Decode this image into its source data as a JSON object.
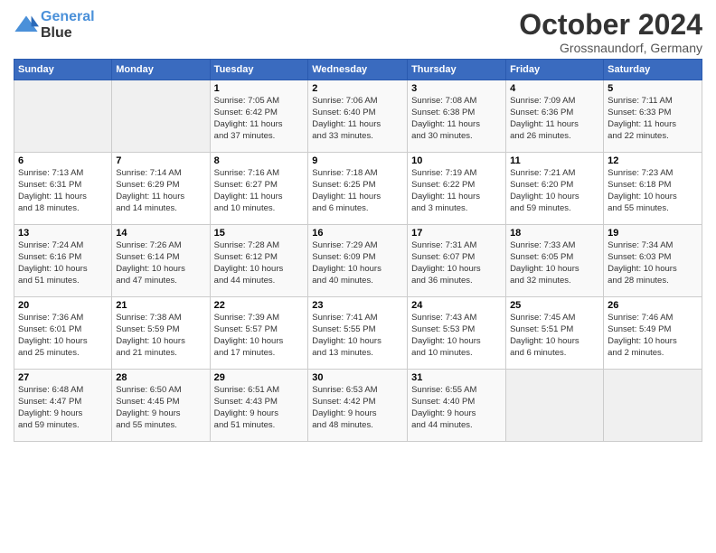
{
  "header": {
    "logo_line1": "General",
    "logo_line2": "Blue",
    "month": "October 2024",
    "location": "Grossnaundorf, Germany"
  },
  "weekdays": [
    "Sunday",
    "Monday",
    "Tuesday",
    "Wednesday",
    "Thursday",
    "Friday",
    "Saturday"
  ],
  "weeks": [
    [
      {
        "day": "",
        "info": ""
      },
      {
        "day": "",
        "info": ""
      },
      {
        "day": "1",
        "info": "Sunrise: 7:05 AM\nSunset: 6:42 PM\nDaylight: 11 hours\nand 37 minutes."
      },
      {
        "day": "2",
        "info": "Sunrise: 7:06 AM\nSunset: 6:40 PM\nDaylight: 11 hours\nand 33 minutes."
      },
      {
        "day": "3",
        "info": "Sunrise: 7:08 AM\nSunset: 6:38 PM\nDaylight: 11 hours\nand 30 minutes."
      },
      {
        "day": "4",
        "info": "Sunrise: 7:09 AM\nSunset: 6:36 PM\nDaylight: 11 hours\nand 26 minutes."
      },
      {
        "day": "5",
        "info": "Sunrise: 7:11 AM\nSunset: 6:33 PM\nDaylight: 11 hours\nand 22 minutes."
      }
    ],
    [
      {
        "day": "6",
        "info": "Sunrise: 7:13 AM\nSunset: 6:31 PM\nDaylight: 11 hours\nand 18 minutes."
      },
      {
        "day": "7",
        "info": "Sunrise: 7:14 AM\nSunset: 6:29 PM\nDaylight: 11 hours\nand 14 minutes."
      },
      {
        "day": "8",
        "info": "Sunrise: 7:16 AM\nSunset: 6:27 PM\nDaylight: 11 hours\nand 10 minutes."
      },
      {
        "day": "9",
        "info": "Sunrise: 7:18 AM\nSunset: 6:25 PM\nDaylight: 11 hours\nand 6 minutes."
      },
      {
        "day": "10",
        "info": "Sunrise: 7:19 AM\nSunset: 6:22 PM\nDaylight: 11 hours\nand 3 minutes."
      },
      {
        "day": "11",
        "info": "Sunrise: 7:21 AM\nSunset: 6:20 PM\nDaylight: 10 hours\nand 59 minutes."
      },
      {
        "day": "12",
        "info": "Sunrise: 7:23 AM\nSunset: 6:18 PM\nDaylight: 10 hours\nand 55 minutes."
      }
    ],
    [
      {
        "day": "13",
        "info": "Sunrise: 7:24 AM\nSunset: 6:16 PM\nDaylight: 10 hours\nand 51 minutes."
      },
      {
        "day": "14",
        "info": "Sunrise: 7:26 AM\nSunset: 6:14 PM\nDaylight: 10 hours\nand 47 minutes."
      },
      {
        "day": "15",
        "info": "Sunrise: 7:28 AM\nSunset: 6:12 PM\nDaylight: 10 hours\nand 44 minutes."
      },
      {
        "day": "16",
        "info": "Sunrise: 7:29 AM\nSunset: 6:09 PM\nDaylight: 10 hours\nand 40 minutes."
      },
      {
        "day": "17",
        "info": "Sunrise: 7:31 AM\nSunset: 6:07 PM\nDaylight: 10 hours\nand 36 minutes."
      },
      {
        "day": "18",
        "info": "Sunrise: 7:33 AM\nSunset: 6:05 PM\nDaylight: 10 hours\nand 32 minutes."
      },
      {
        "day": "19",
        "info": "Sunrise: 7:34 AM\nSunset: 6:03 PM\nDaylight: 10 hours\nand 28 minutes."
      }
    ],
    [
      {
        "day": "20",
        "info": "Sunrise: 7:36 AM\nSunset: 6:01 PM\nDaylight: 10 hours\nand 25 minutes."
      },
      {
        "day": "21",
        "info": "Sunrise: 7:38 AM\nSunset: 5:59 PM\nDaylight: 10 hours\nand 21 minutes."
      },
      {
        "day": "22",
        "info": "Sunrise: 7:39 AM\nSunset: 5:57 PM\nDaylight: 10 hours\nand 17 minutes."
      },
      {
        "day": "23",
        "info": "Sunrise: 7:41 AM\nSunset: 5:55 PM\nDaylight: 10 hours\nand 13 minutes."
      },
      {
        "day": "24",
        "info": "Sunrise: 7:43 AM\nSunset: 5:53 PM\nDaylight: 10 hours\nand 10 minutes."
      },
      {
        "day": "25",
        "info": "Sunrise: 7:45 AM\nSunset: 5:51 PM\nDaylight: 10 hours\nand 6 minutes."
      },
      {
        "day": "26",
        "info": "Sunrise: 7:46 AM\nSunset: 5:49 PM\nDaylight: 10 hours\nand 2 minutes."
      }
    ],
    [
      {
        "day": "27",
        "info": "Sunrise: 6:48 AM\nSunset: 4:47 PM\nDaylight: 9 hours\nand 59 minutes."
      },
      {
        "day": "28",
        "info": "Sunrise: 6:50 AM\nSunset: 4:45 PM\nDaylight: 9 hours\nand 55 minutes."
      },
      {
        "day": "29",
        "info": "Sunrise: 6:51 AM\nSunset: 4:43 PM\nDaylight: 9 hours\nand 51 minutes."
      },
      {
        "day": "30",
        "info": "Sunrise: 6:53 AM\nSunset: 4:42 PM\nDaylight: 9 hours\nand 48 minutes."
      },
      {
        "day": "31",
        "info": "Sunrise: 6:55 AM\nSunset: 4:40 PM\nDaylight: 9 hours\nand 44 minutes."
      },
      {
        "day": "",
        "info": ""
      },
      {
        "day": "",
        "info": ""
      }
    ]
  ]
}
